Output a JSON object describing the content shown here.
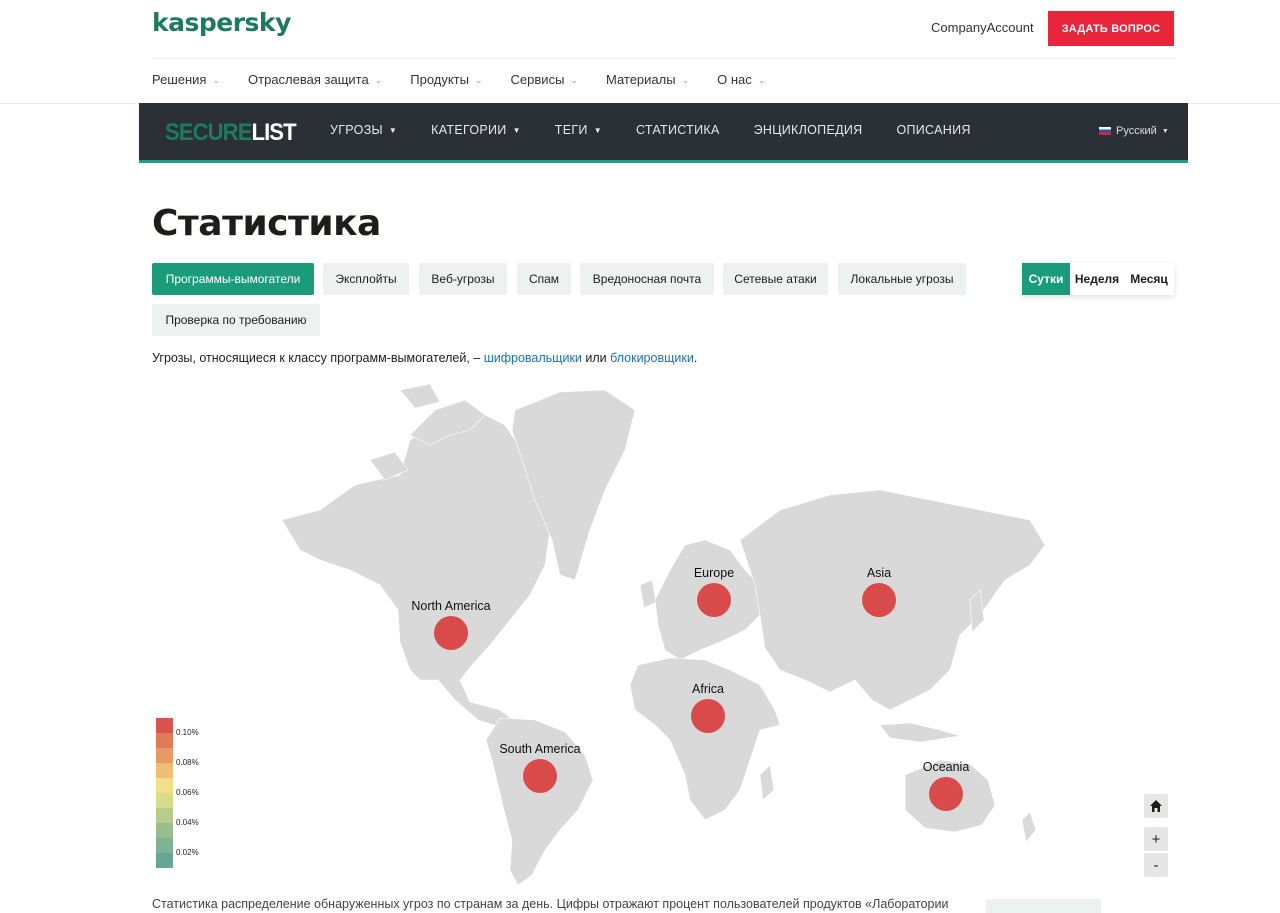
{
  "header": {
    "logo": "kaspersky",
    "account": "CompanyAccount",
    "ask_button": "ЗАДАТЬ ВОПРОС",
    "nav": [
      {
        "label": "Решения"
      },
      {
        "label": "Отраслевая защита"
      },
      {
        "label": "Продукты"
      },
      {
        "label": "Сервисы"
      },
      {
        "label": "Материалы"
      },
      {
        "label": "О нас"
      }
    ]
  },
  "securelist": {
    "logo_a": "SECURE",
    "logo_b": "LIST",
    "nav": [
      {
        "label": "УГРОЗЫ"
      },
      {
        "label": "КАТЕГОРИИ"
      },
      {
        "label": "ТЕГИ"
      },
      {
        "label": "СТАТИСТИКА"
      },
      {
        "label": "ЭНЦИКЛОПЕДИЯ"
      },
      {
        "label": "ОПИСАНИЯ"
      }
    ],
    "language": "Русский"
  },
  "page": {
    "title": "Статистика",
    "tabs": [
      "Программы-вымогатели",
      "Эксплойты",
      "Веб-угрозы",
      "Спам",
      "Вредоносная почта",
      "Сетевые атаки",
      "Локальные угрозы",
      "Проверка по требованию"
    ],
    "periods": [
      "Сутки",
      "Неделя",
      "Месяц"
    ],
    "description": {
      "prefix": "Угрозы, относящиеся к классу программ-вымогателей, – ",
      "link1": "шифровальщики",
      "middle": " или ",
      "link2": "блокировщики",
      "suffix": "."
    },
    "regions": [
      "Europe",
      "Asia",
      "North America",
      "Africa",
      "South America",
      "Oceania"
    ],
    "legend": [
      "0.10%",
      "0.08%",
      "0.06%",
      "0.04%",
      "0.02%"
    ],
    "legend_colors": [
      "#d9534f",
      "#df7a5a",
      "#e69a67",
      "#ecbe78",
      "#f1df8a",
      "#d7dc8c",
      "#b6cd8b",
      "#96bf8c",
      "#7cb392",
      "#66a695"
    ],
    "marker_color": "#d94a4a",
    "land_color": "#d9d9d9",
    "map_controls": {
      "home": "home-icon",
      "zoom_in": "+",
      "zoom_out": "-"
    },
    "bottom_text": "Статистика распределение обнаруженных угроз по странам за день. Цифры отражают процент пользователей продуктов «Лаборатории"
  }
}
